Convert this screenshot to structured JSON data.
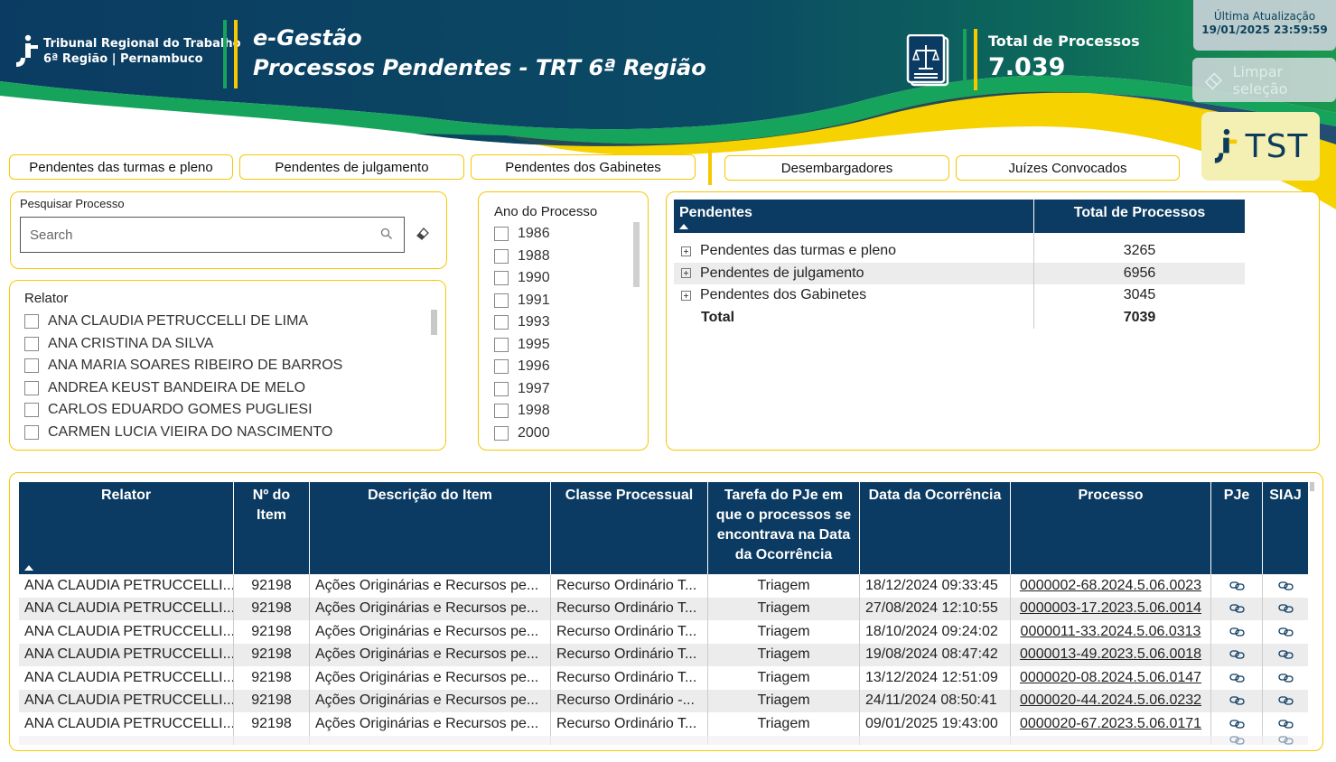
{
  "brand": {
    "line1": "Tribunal Regional do Trabalho",
    "line2": "6ª Região | Pernambuco"
  },
  "header": {
    "title_line1": "e-Gestão",
    "title_line2": "Processos Pendentes - TRT 6ª Região"
  },
  "kpi": {
    "label": "Total de Processos",
    "value": "7.039"
  },
  "update": {
    "label": "Última Atualização",
    "datetime": "19/01/2025 23:59:59"
  },
  "clear_button": "Limpar seleção",
  "tst_logo": "TST",
  "nav": [
    "Pendentes das turmas e pleno",
    "Pendentes de julgamento",
    "Pendentes dos Gabinetes",
    "Desembargadores",
    "Juízes Convocados"
  ],
  "search": {
    "title": "Pesquisar Processo",
    "placeholder": "Search"
  },
  "relator_slicer": {
    "title": "Relator",
    "items": [
      "ANA CLAUDIA PETRUCCELLI DE LIMA",
      "ANA CRISTINA DA SILVA",
      "ANA MARIA SOARES RIBEIRO DE BARROS",
      "ANDREA KEUST BANDEIRA DE MELO",
      "CARLOS EDUARDO GOMES PUGLIESI",
      "CARMEN LUCIA VIEIRA DO NASCIMENTO"
    ]
  },
  "ano_slicer": {
    "title": "Ano do Processo",
    "items": [
      "1986",
      "1988",
      "1990",
      "1991",
      "1993",
      "1995",
      "1996",
      "1997",
      "1998",
      "2000"
    ]
  },
  "matrix": {
    "header_col1": "Pendentes",
    "header_col2": "Total de Processos",
    "rows": [
      {
        "label": "Pendentes das turmas e pleno",
        "value": "3265"
      },
      {
        "label": "Pendentes de julgamento",
        "value": "6956"
      },
      {
        "label": "Pendentes dos Gabinetes",
        "value": "3045"
      }
    ],
    "total_label": "Total",
    "total_value": "7039"
  },
  "table": {
    "headers": [
      "Relator",
      "Nº do Item",
      "Descrição do Item",
      "Classe Processual",
      "Tarefa do PJe em que o processos se encontrava na Data da Ocorrência",
      "Data da Ocorrência",
      "Processo",
      "PJe",
      "SIAJ"
    ],
    "rows": [
      [
        "ANA CLAUDIA PETRUCCELLI...",
        "92198",
        "Ações Originárias e Recursos pe...",
        "Recurso Ordinário T...",
        "Triagem",
        "18/12/2024 09:33:45",
        "0000002-68.2024.5.06.0023"
      ],
      [
        "ANA CLAUDIA PETRUCCELLI...",
        "92198",
        "Ações Originárias e Recursos pe...",
        "Recurso Ordinário T...",
        "Triagem",
        "27/08/2024 12:10:55",
        "0000003-17.2023.5.06.0014"
      ],
      [
        "ANA CLAUDIA PETRUCCELLI...",
        "92198",
        "Ações Originárias e Recursos pe...",
        "Recurso Ordinário T...",
        "Triagem",
        "18/10/2024 09:24:02",
        "0000011-33.2024.5.06.0313"
      ],
      [
        "ANA CLAUDIA PETRUCCELLI...",
        "92198",
        "Ações Originárias e Recursos pe...",
        "Recurso Ordinário T...",
        "Triagem",
        "19/08/2024 08:47:42",
        "0000013-49.2023.5.06.0018"
      ],
      [
        "ANA CLAUDIA PETRUCCELLI...",
        "92198",
        "Ações Originárias e Recursos pe...",
        "Recurso Ordinário T...",
        "Triagem",
        "13/12/2024 12:51:09",
        "0000020-08.2024.5.06.0147"
      ],
      [
        "ANA CLAUDIA PETRUCCELLI...",
        "92198",
        "Ações Originárias e Recursos pe...",
        "Recurso Ordinário -...",
        "Triagem",
        "24/11/2024 08:50:41",
        "0000020-44.2024.5.06.0232"
      ],
      [
        "ANA CLAUDIA PETRUCCELLI...",
        "92198",
        "Ações Originárias e Recursos pe...",
        "Recurso Ordinário T...",
        "Triagem",
        "09/01/2025 19:43:00",
        "0000020-67.2023.5.06.0171"
      ]
    ]
  },
  "colors": {
    "navy": "#0b3b62",
    "yellow": "#f6c800",
    "green": "#16a35c"
  }
}
